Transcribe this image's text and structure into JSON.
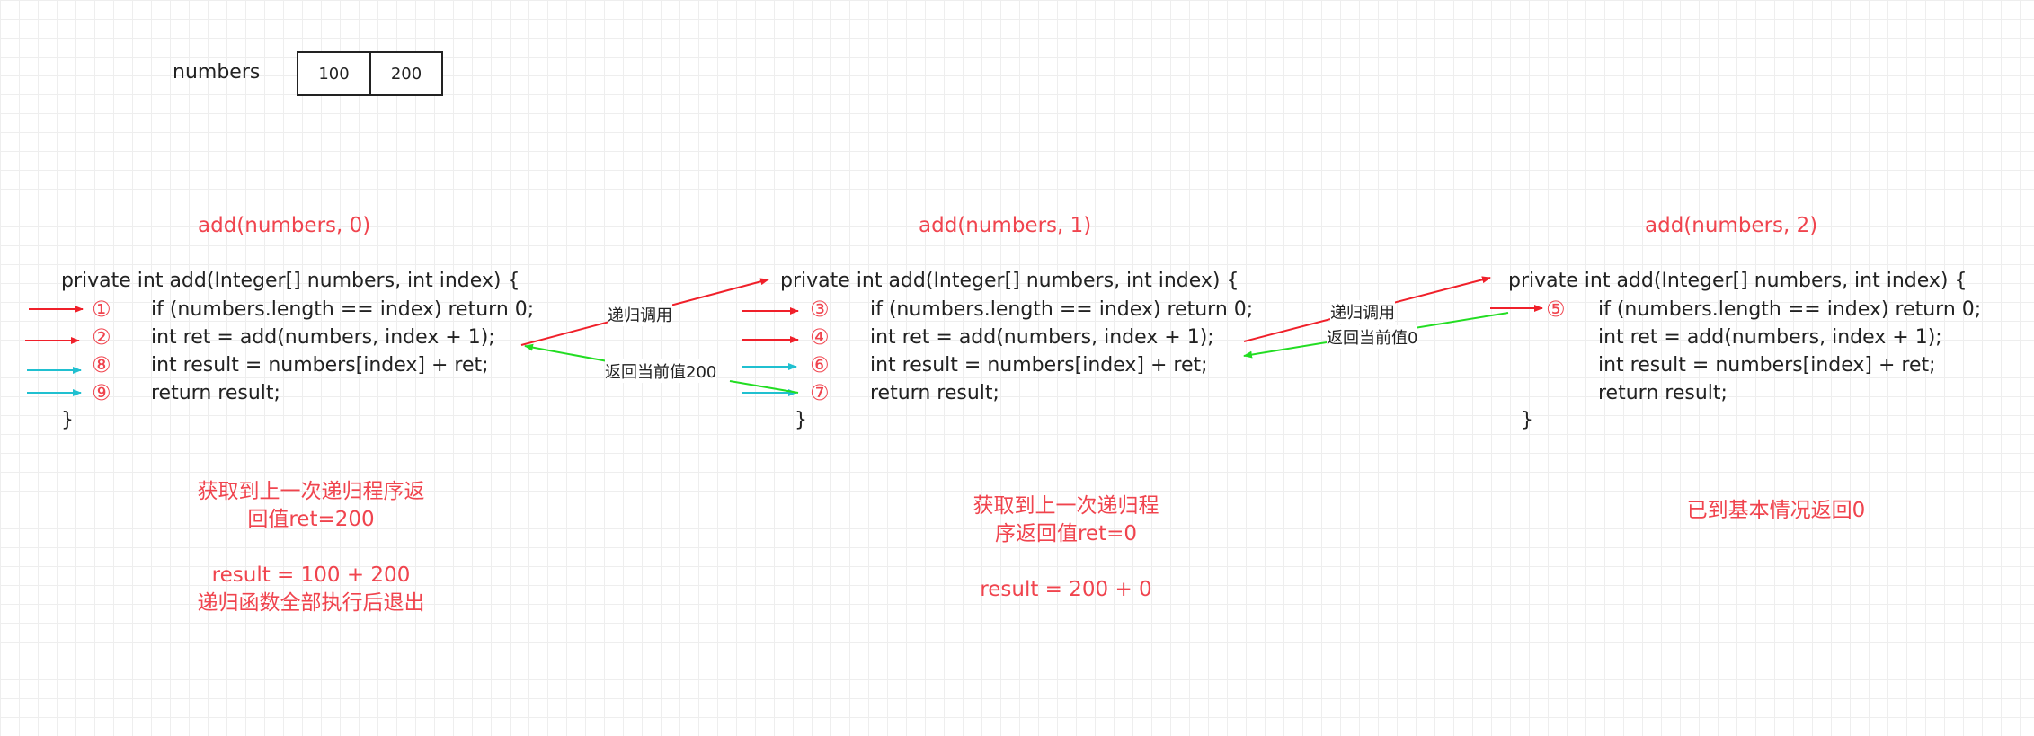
{
  "array": {
    "label": "numbers",
    "cells": [
      "100",
      "200"
    ]
  },
  "frames": [
    {
      "title": "add(numbers, 0)",
      "signature": "private int add(Integer[] numbers, int index) {",
      "lines": [
        "if (numbers.length == index) return 0;",
        "int ret = add(numbers, index + 1);",
        "int result = numbers[index] + ret;",
        "return result;"
      ],
      "close": "}",
      "markers": [
        "①",
        "②",
        "⑧",
        "⑨"
      ],
      "note": [
        "获取到上一次递归程序返",
        "回值ret=200",
        "",
        "result = 100 + 200",
        "递归函数全部执行后退出"
      ]
    },
    {
      "title": "add(numbers, 1)",
      "signature": "private int add(Integer[] numbers, int index) {",
      "lines": [
        "if (numbers.length == index) return 0;",
        "int ret = add(numbers, index + 1);",
        "int result = numbers[index] + ret;",
        "return result;"
      ],
      "close": "}",
      "markers": [
        "③",
        "④",
        "⑥",
        "⑦"
      ],
      "note": [
        "获取到上一次递归程",
        "序返回值ret=0",
        "",
        "result = 200 + 0"
      ]
    },
    {
      "title": "add(numbers, 2)",
      "signature": "private int add(Integer[] numbers, int index) {",
      "lines": [
        "if (numbers.length == index) return 0;",
        "int ret = add(numbers, index + 1);",
        "int result = numbers[index] + ret;",
        "return result;"
      ],
      "close": "}",
      "markers": [
        "⑤"
      ],
      "note": [
        "已到基本情况返回0"
      ]
    }
  ],
  "arrow_labels": {
    "call_1": "递归调用",
    "return_1": "返回当前值200",
    "call_2": "递归调用",
    "return_2": "返回当前值0"
  },
  "colors": {
    "call": "#f0202a",
    "return": "#22dd22",
    "resume": "#20c0d0",
    "accent": "#f0444e"
  }
}
